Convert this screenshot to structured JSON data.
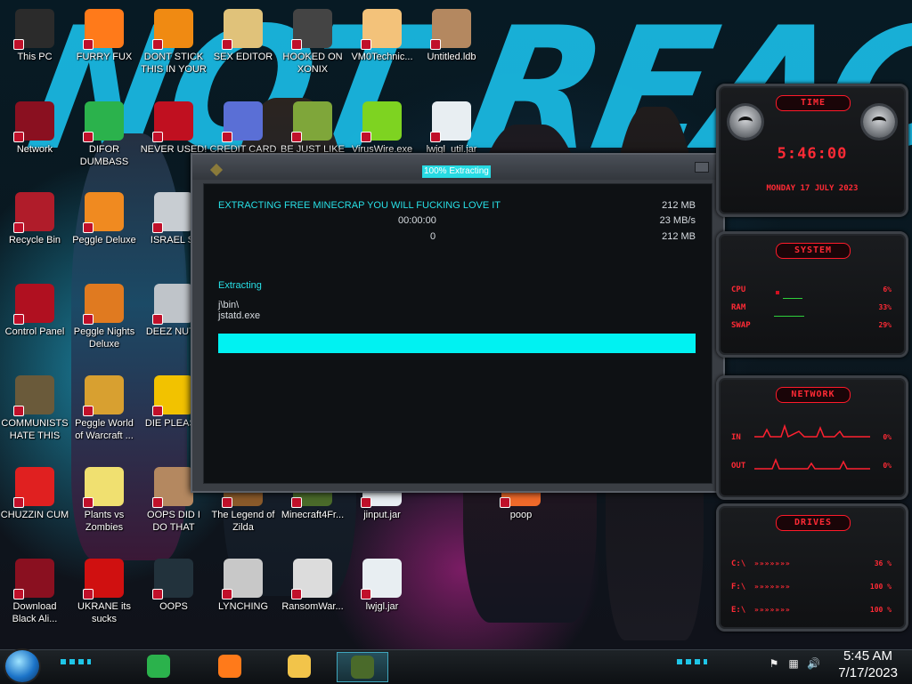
{
  "wallpaper": {
    "text": "NOT REACT"
  },
  "desktop_icons": [
    {
      "label": "This PC",
      "icon": "computer-icon",
      "color": "#2b2b2b"
    },
    {
      "label": "FURRY FUX",
      "icon": "firefox-icon",
      "color": "#ff7a1a"
    },
    {
      "label": "DONT STICK THIS IN YOUR ASS",
      "icon": "vlc-cone-icon",
      "color": "#f08a12"
    },
    {
      "label": "SEX EDITOR",
      "icon": "hxd-icon",
      "color": "#e0c27a"
    },
    {
      "label": "HOOKED ON XONIX",
      "icon": "xonix-icon",
      "color": "#444444"
    },
    {
      "label": "VM0Technic...",
      "icon": "doctor-icon",
      "color": "#f3c27a"
    },
    {
      "label": "Untitled.ldb",
      "icon": "portrait-icon",
      "color": "#b48860"
    },
    {
      "label": "Network",
      "icon": "alien-skull-icon",
      "color": "#8a1020"
    },
    {
      "label": "DIFOR DUMBASS",
      "icon": "feedly-icon",
      "color": "#2bb24c"
    },
    {
      "label": "NEVER USED!",
      "icon": "devcpp-icon",
      "color": "#c01020"
    },
    {
      "label": "CREDIT CARD",
      "icon": "credit-card-icon",
      "color": "#5a6fd6"
    },
    {
      "label": "BE JUST LIKE",
      "icon": "gnome-icon",
      "color": "#7fa63a"
    },
    {
      "label": "VirusWire.exe",
      "icon": "lime-icon",
      "color": "#7ed321"
    },
    {
      "label": "lwjgl_util.jar",
      "icon": "java-icon",
      "color": "#e8eef2"
    },
    {
      "label": "Recycle Bin",
      "icon": "recycle-bin-icon",
      "color": "#b01c2a"
    },
    {
      "label": "Peggle Deluxe",
      "icon": "peggle-icon",
      "color": "#f08a20"
    },
    {
      "label": "ISRAEL SI",
      "icon": "window-stack-icon",
      "color": "#c8cdd2"
    },
    {
      "label": "Control Panel",
      "icon": "control-panel-icon",
      "color": "#b01020"
    },
    {
      "label": "Peggle Nights Deluxe",
      "icon": "peggle-icon",
      "color": "#e07a20"
    },
    {
      "label": "DEEZ NUTS",
      "icon": "window-stack-icon",
      "color": "#bfc4c9"
    },
    {
      "label": "COMMUNISTS HATE THIS GAME",
      "icon": "money-bag-icon",
      "color": "#6a5a3a"
    },
    {
      "label": "Peggle World of Warcraft ...",
      "icon": "peggle-icon",
      "color": "#d8a030"
    },
    {
      "label": "DIE PLEASE",
      "icon": "de-icon",
      "color": "#f2c200"
    },
    {
      "label": "CHUZZIN CUM",
      "icon": "chuzzle-icon",
      "color": "#e02020"
    },
    {
      "label": "Plants vs Zombies",
      "icon": "flower-icon",
      "color": "#f0e070"
    },
    {
      "label": "OOPS DID I DO THAT",
      "icon": "portrait-icon",
      "color": "#b48860"
    },
    {
      "label": "The Legend of Zilda",
      "icon": "game-sprite-icon",
      "color": "#8a5a2a"
    },
    {
      "label": "Minecraft4Fr...",
      "icon": "minecraft-icon",
      "color": "#4a6a2a"
    },
    {
      "label": "jinput.jar",
      "icon": "java-icon",
      "color": "#e8eef2"
    },
    {
      "label": "poop",
      "icon": "power-icon",
      "color": "#f06a2a"
    },
    {
      "label": "Download Black Ali...",
      "icon": "alien-skull-icon",
      "color": "#8a1020"
    },
    {
      "label": "UKRANE its sucks",
      "icon": "radiation-icon",
      "color": "#d01010"
    },
    {
      "label": "OOPS",
      "icon": "monitor-icon",
      "color": "#22323c"
    },
    {
      "label": "LYNCHING",
      "icon": "noose-icon",
      "color": "#c8c8c8"
    },
    {
      "label": "RansomWar...",
      "icon": "skull-icon",
      "color": "#dcdcdc"
    },
    {
      "label": "lwjgl.jar",
      "icon": "java-icon",
      "color": "#e8eef2"
    }
  ],
  "installer": {
    "title": "100% Extracting",
    "heading": "EXTRACTING FREE MINECRAP YOU WILL FUCKING LOVE IT",
    "size_total": "212 MB",
    "time_elapsed": "00:00:00",
    "speed": "23 MB/s",
    "processed": "0",
    "size_done": "212 MB",
    "status": "Extracting",
    "path": "j\\bin\\",
    "file": "jstatd.exe",
    "progress": 1.0
  },
  "gadget": {
    "time": {
      "header": "TIME",
      "clock": "5:46:00",
      "date": "MONDAY 17 JULY 2023"
    },
    "system": {
      "header": "SYSTEM",
      "rows": [
        {
          "label": "CPU",
          "value": "6%"
        },
        {
          "label": "RAM",
          "value": "33%"
        },
        {
          "label": "SWAP",
          "value": "29%"
        }
      ]
    },
    "network": {
      "header": "NETWORK",
      "rows": [
        {
          "label": "IN",
          "value": "0%"
        },
        {
          "label": "OUT",
          "value": "0%"
        }
      ]
    },
    "drives": {
      "header": "DRIVES",
      "rows": [
        {
          "label": "C:\\",
          "value": "36 %"
        },
        {
          "label": "F:\\",
          "value": "100 %"
        },
        {
          "label": "E:\\",
          "value": "100 %"
        }
      ]
    }
  },
  "taskbar": {
    "buttons": [
      {
        "name": "feedly",
        "icon": "feedly-icon",
        "color": "#2bb24c"
      },
      {
        "name": "firefox",
        "icon": "firefox-icon",
        "color": "#ff7a1a"
      },
      {
        "name": "file-explorer",
        "icon": "folder-icon",
        "color": "#f2c44a"
      },
      {
        "name": "minecraft-installer",
        "icon": "minecraft-icon",
        "color": "#4a6a2a",
        "active": true
      }
    ],
    "clock": {
      "time": "5:45 AM",
      "date": "7/17/2023"
    }
  }
}
